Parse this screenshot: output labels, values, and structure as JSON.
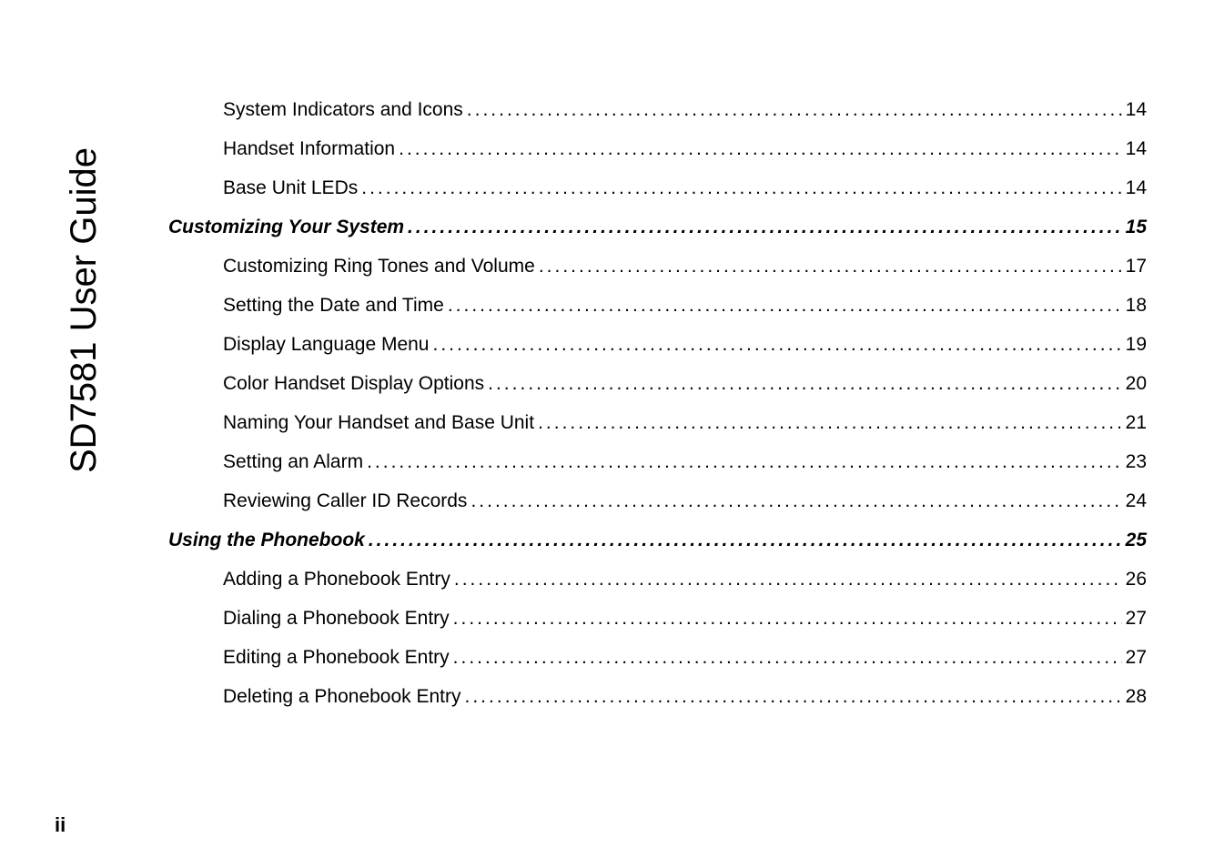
{
  "sidebar_title": "SD7581 User Guide",
  "page_number": "ii",
  "toc": [
    {
      "title": "System Indicators and Icons",
      "page": "14",
      "level": "sub"
    },
    {
      "title": "Handset Information",
      "page": "14",
      "level": "sub"
    },
    {
      "title": "Base Unit LEDs",
      "page": "14",
      "level": "sub"
    },
    {
      "title": "Customizing Your System",
      "page": "15",
      "level": "heading"
    },
    {
      "title": "Customizing Ring Tones and Volume",
      "page": "17",
      "level": "sub"
    },
    {
      "title": "Setting the Date and Time",
      "page": "18",
      "level": "sub"
    },
    {
      "title": "Display Language Menu",
      "page": "19",
      "level": "sub"
    },
    {
      "title": "Color Handset Display Options",
      "page": "20",
      "level": "sub"
    },
    {
      "title": "Naming Your Handset and Base Unit",
      "page": "21",
      "level": "sub"
    },
    {
      "title": "Setting an Alarm",
      "page": "23",
      "level": "sub"
    },
    {
      "title": "Reviewing Caller ID Records",
      "page": "24",
      "level": "sub"
    },
    {
      "title": "Using the Phonebook",
      "page": "25",
      "level": "heading"
    },
    {
      "title": "Adding a Phonebook Entry",
      "page": "26",
      "level": "sub"
    },
    {
      "title": "Dialing a Phonebook Entry",
      "page": "27",
      "level": "sub"
    },
    {
      "title": "Editing a Phonebook Entry",
      "page": "27",
      "level": "sub"
    },
    {
      "title": "Deleting a Phonebook Entry",
      "page": "28",
      "level": "sub"
    }
  ]
}
